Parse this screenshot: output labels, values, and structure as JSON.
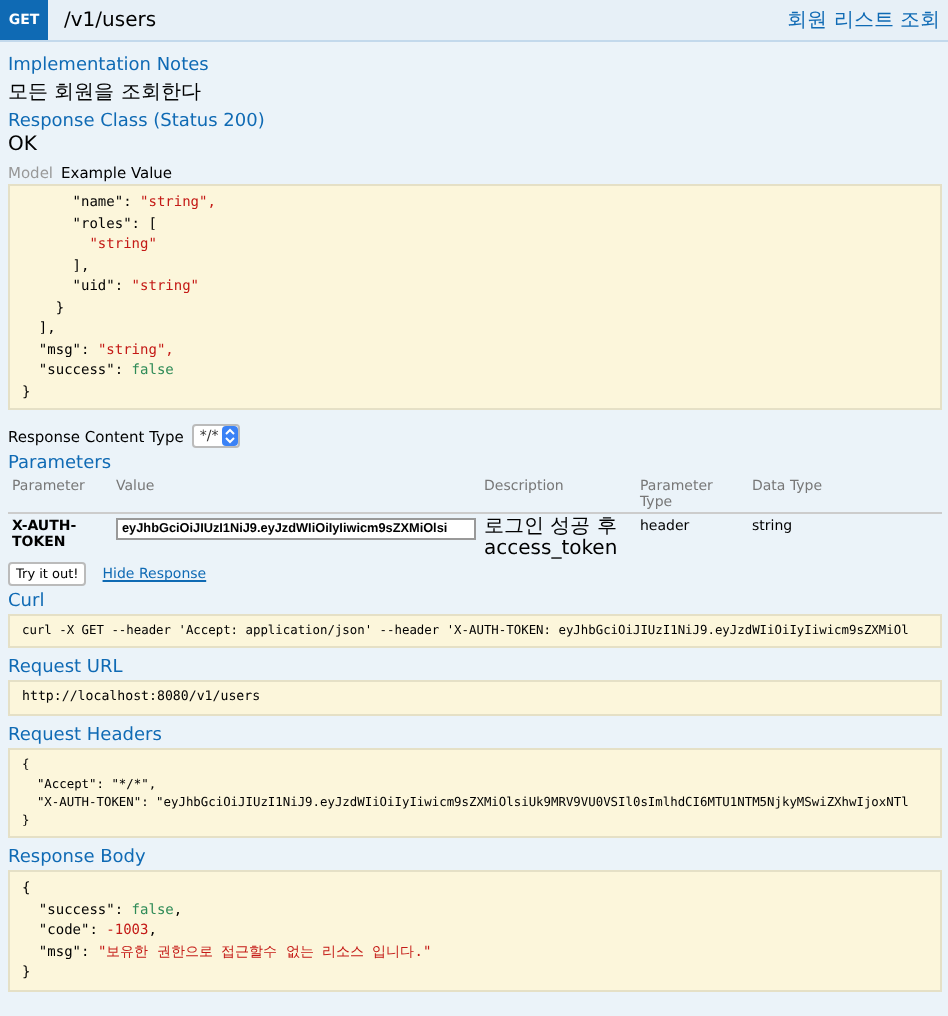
{
  "header": {
    "method": "GET",
    "path": "/v1/users",
    "summary": "회원 리스트 조회"
  },
  "implementation_notes": {
    "title": "Implementation Notes",
    "text": "모든 회원을 조회한다"
  },
  "response_class": {
    "title": "Response Class (Status 200)",
    "text": "OK"
  },
  "model_tabs": [
    {
      "label": "Model",
      "selected": false
    },
    {
      "label": "Example Value",
      "selected": true
    }
  ],
  "example_value": [
    [
      {
        "kind": "plain",
        "text": "      \"name\": "
      },
      {
        "kind": "string",
        "text": "\"string\","
      }
    ],
    [
      {
        "kind": "plain",
        "text": "      \"roles\": ["
      }
    ],
    [
      {
        "kind": "string",
        "text": "        \"string\""
      }
    ],
    [
      {
        "kind": "plain",
        "text": "      ],"
      }
    ],
    [
      {
        "kind": "plain",
        "text": "      \"uid\": "
      },
      {
        "kind": "string",
        "text": "\"string\""
      }
    ],
    [
      {
        "kind": "plain",
        "text": "    }"
      }
    ],
    [
      {
        "kind": "plain",
        "text": "  ],"
      }
    ],
    [
      {
        "kind": "plain",
        "text": "  \"msg\": "
      },
      {
        "kind": "string",
        "text": "\"string\","
      }
    ],
    [
      {
        "kind": "plain",
        "text": "  \"success\": "
      },
      {
        "kind": "boolean",
        "text": "false"
      }
    ],
    [
      {
        "kind": "plain",
        "text": "}"
      }
    ]
  ],
  "response_content_type": {
    "label": "Response Content Type",
    "value": "*/*"
  },
  "parameters": {
    "title": "Parameters",
    "columns": [
      "Parameter",
      "Value",
      "Description",
      "Parameter Type",
      "Data Type"
    ],
    "rows": [
      {
        "parameter": "X-AUTH-TOKEN",
        "value": "eyJhbGciOiJIUzI1NiJ9.eyJzdWIiOiIyIiwicm9sZXMiOlsi",
        "description": "로그인 성공 후 access_token",
        "parameter_type": "header",
        "data_type": "string"
      }
    ]
  },
  "actions": {
    "try": "Try it out!",
    "hide": "Hide Response"
  },
  "curl": {
    "title": "Curl",
    "lines": [
      "curl -X GET --header 'Accept: application/json' --header 'X-AUTH-TOKEN: eyJhbGciOiJIUzI1NiJ9.eyJzdWIiOiIyIiwicm9sZXMiOl"
    ]
  },
  "request_url": {
    "title": "Request URL",
    "lines": [
      "http://localhost:8080/v1/users"
    ]
  },
  "request_headers": {
    "title": "Request Headers",
    "lines": [
      "{",
      "  \"Accept\": \"*/*\",",
      "  \"X-AUTH-TOKEN\": \"eyJhbGciOiJIUzI1NiJ9.eyJzdWIiOiIyIiwicm9sZXMiOlsiUk9MRV9VU0VSIl0sImlhdCI6MTU1NTM5NjkyMSwiZXhwIjoxNTl",
      "}"
    ]
  },
  "response_body": {
    "title": "Response Body",
    "lines": [
      [
        {
          "kind": "plain",
          "text": "{"
        }
      ],
      [
        {
          "kind": "plain",
          "text": "  \"success\": "
        },
        {
          "kind": "boolean",
          "text": "false"
        },
        {
          "kind": "plain",
          "text": ","
        }
      ],
      [
        {
          "kind": "plain",
          "text": "  \"code\": "
        },
        {
          "kind": "number",
          "text": "-1003"
        },
        {
          "kind": "plain",
          "text": ","
        }
      ],
      [
        {
          "kind": "plain",
          "text": "  \"msg\": "
        },
        {
          "kind": "string",
          "text": "\"보유한 권한으로 접근할수 없는 리소스 입니다.\""
        }
      ],
      [
        {
          "kind": "plain",
          "text": "}"
        }
      ]
    ]
  }
}
